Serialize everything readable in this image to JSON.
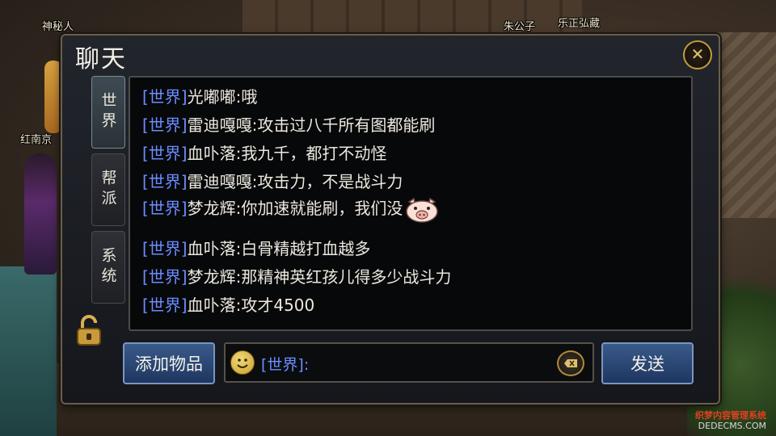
{
  "world": {
    "npc_names": [
      {
        "id": "shenmiren",
        "label": "神秘人"
      },
      {
        "id": "zhugongzi",
        "label": "朱公子"
      },
      {
        "id": "lezhenghongzang",
        "label": "乐正弘藏"
      },
      {
        "id": "hongnanjing",
        "label": "红南京"
      }
    ]
  },
  "chat_panel": {
    "title": "聊天",
    "close_icon": "close-icon",
    "tabs": [
      {
        "label": "世界",
        "active": true
      },
      {
        "label": "帮派",
        "active": false
      },
      {
        "label": "系统",
        "active": false
      }
    ],
    "lock_icon": "lock-icon",
    "messages": [
      {
        "channel": "[世界]",
        "sender": "光嘟嘟",
        "text": "哦"
      },
      {
        "channel": "[世界]",
        "sender": "雷迪嘎嘎",
        "text": "攻击过八千所有图都能刷"
      },
      {
        "channel": "[世界]",
        "sender": "血卟落",
        "text": "我九千，都打不动怪"
      },
      {
        "channel": "[世界]",
        "sender": "雷迪嘎嘎",
        "text": "攻击力，不是战斗力"
      },
      {
        "channel": "[世界]",
        "sender": "梦龙辉",
        "text": "你加速就能刷，我们没",
        "emoji": "pig-emoji"
      },
      {
        "channel": "[世界]",
        "sender": "血卟落",
        "text": "白骨精越打血越多"
      },
      {
        "channel": "[世界]",
        "sender": "梦龙辉",
        "text": "那精神英红孩儿得多少战斗力"
      },
      {
        "channel": "[世界]",
        "sender": "血卟落",
        "text": "攻才4500"
      }
    ],
    "bottom": {
      "add_item_label": "添加物品",
      "input_prefix": "[世界]:",
      "input_value": "",
      "send_label": "发送"
    }
  },
  "watermark": {
    "line1": "织梦内容管理系统",
    "line2": "DEDECMS.COM"
  }
}
